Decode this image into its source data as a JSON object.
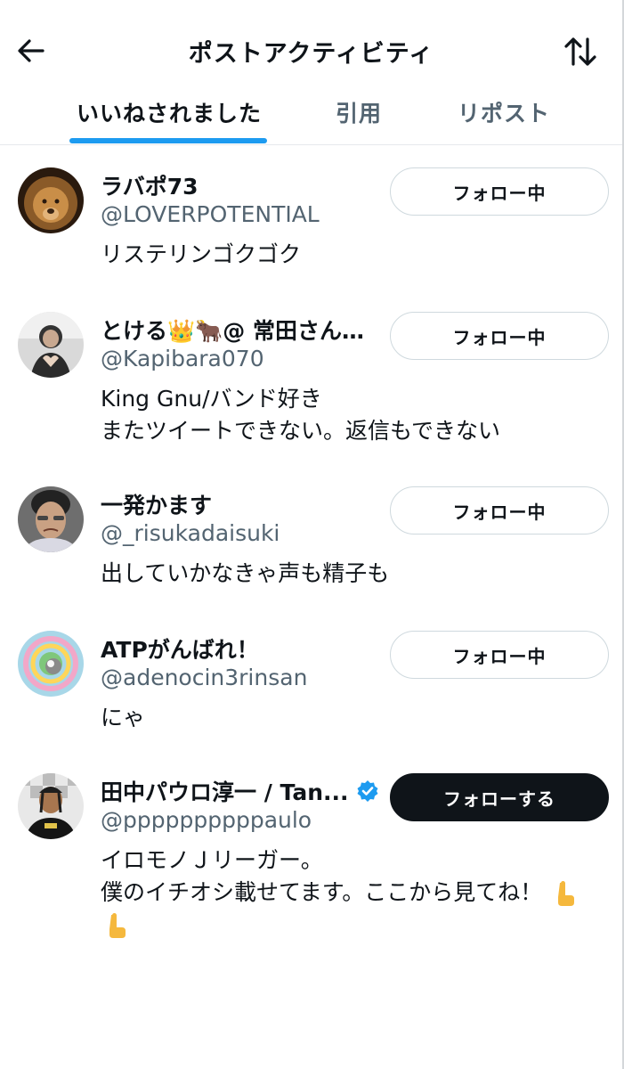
{
  "header": {
    "title": "ポストアクティビティ",
    "back_icon": "arrow-left-icon",
    "sort_icon": "sort-arrows-icon"
  },
  "tabs": [
    {
      "label": "いいねされました",
      "active": true
    },
    {
      "label": "引用",
      "active": false
    },
    {
      "label": "リポスト",
      "active": false
    }
  ],
  "colors": {
    "accent": "#1d9bf0",
    "text": "#0f1419",
    "muted": "#536471",
    "follow_bg": "#0f1419"
  },
  "users": [
    {
      "name": "ラバポ73",
      "handle": "@LOVERPOTENTIAL",
      "bio": [
        "リステリンゴクゴク"
      ],
      "button": "フォロー中",
      "verified": false
    },
    {
      "name": "とける👑🐂@ 常田さん…",
      "handle": "@Kapibara070",
      "bio": [
        "King Gnu/バンド好き",
        "またツイートできない。返信もできない"
      ],
      "button": "フォロー中",
      "verified": false
    },
    {
      "name": "一発かます",
      "handle": "@_risukadaisuki",
      "bio": [
        "出していかなきゃ声も精子も"
      ],
      "button": "フォロー中",
      "verified": false
    },
    {
      "name": "ATPがんばれ！",
      "handle": "@adenocin3rinsan",
      "bio": [
        "にゃ"
      ],
      "button": "フォロー中",
      "verified": false
    },
    {
      "name": "田中パウロ淳一 / Tan...",
      "handle": "@ppppppppppaulo",
      "bio": [
        "イロモノＪリーガー。",
        "僕のイチオシ載せてます。ここから見てね！",
        ""
      ],
      "button": "フォローする",
      "verified": true,
      "bio_emoji": "pointing-down-icon"
    }
  ]
}
